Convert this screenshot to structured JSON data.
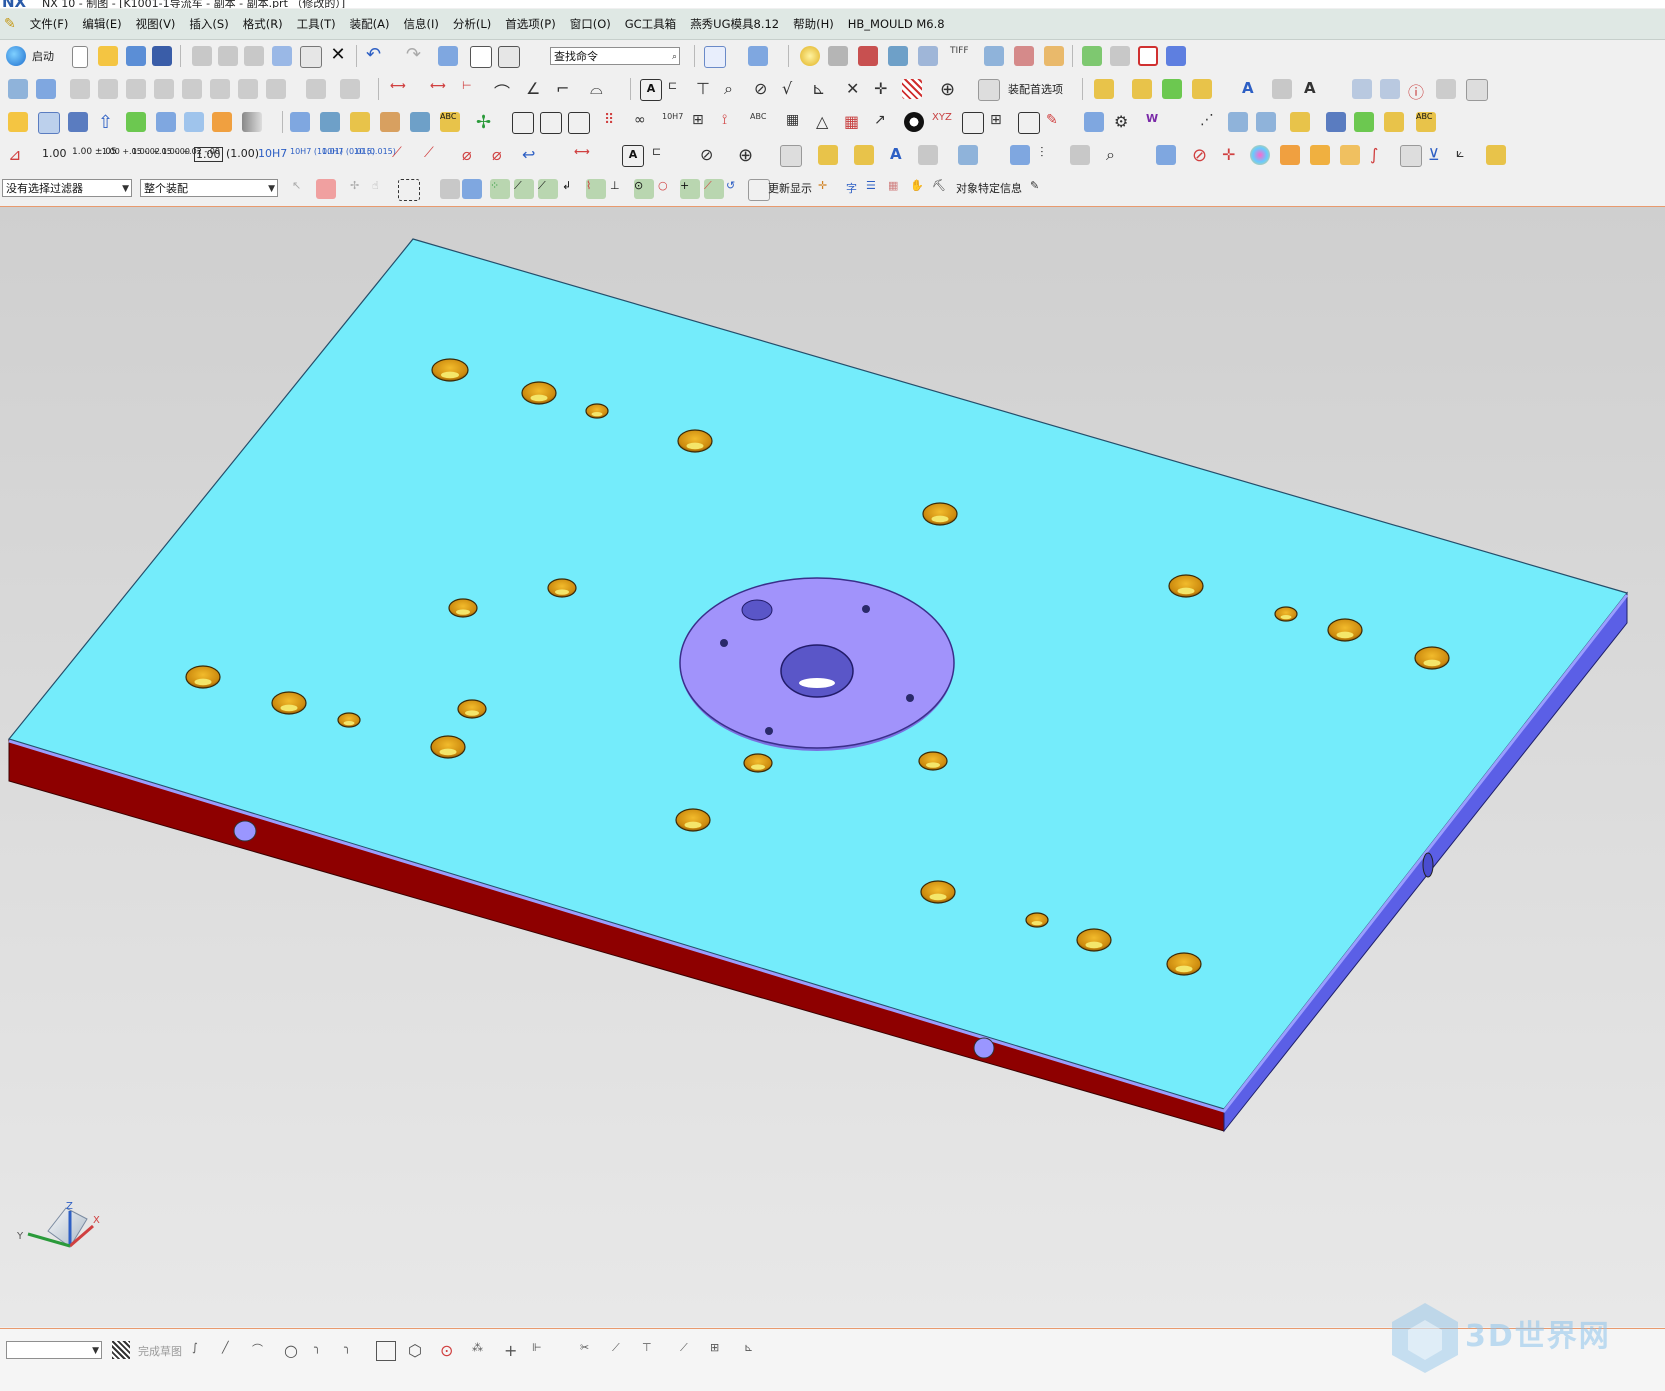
{
  "window": {
    "logo": "NX",
    "title": "NX 10 - 制图 - [K1001-1导流车 - 副本 - 副本.prt （修改的）]"
  },
  "menu": {
    "items": [
      "文件(F)",
      "编辑(E)",
      "视图(V)",
      "插入(S)",
      "格式(R)",
      "工具(T)",
      "装配(A)",
      "信息(I)",
      "分析(L)",
      "首选项(P)",
      "窗口(O)",
      "GC工具箱",
      "燕秀UG模具8.12",
      "帮助(H)",
      "HB_MOULD M6.8"
    ]
  },
  "toolbar1": {
    "start_label": "启动",
    "search_placeholder": "查找命令"
  },
  "toolbar2": {
    "assembly_prefs_label": "装配首选项"
  },
  "toolbar4": {
    "dim_100": "1.00",
    "tol_1": "1.00 ±.05",
    "tol_2": "1.00 +.05 -.02",
    "tol_3": "1.00 +.05 -.00",
    "tol_4": "1.00 +.02 -.00",
    "boxed_dim": "1.00",
    "paren_dim": "(1.00)",
    "fit_1": "10H7",
    "fit_2": "10H7 (10.01)",
    "fit_3": "10H7 (0.015)",
    "fit_4": "10 (0.015)"
  },
  "selection_bar": {
    "filter_value": "没有选择过滤器",
    "scope_value": "整个装配",
    "update_display_label": "更新显示",
    "char_label": "字",
    "object_info_label": "对象特定信息"
  },
  "sketch_bar": {
    "finish_sketch_label": "完成草图"
  },
  "triad": {
    "x": "X",
    "y": "Y",
    "z": "Z"
  },
  "watermark": {
    "text": "3D世界网"
  },
  "colors": {
    "plate_top": "#74ecfb",
    "plate_front": "#8e0000",
    "plate_side": "#5b5fe6",
    "counterbore": "#d79216",
    "hole_inner": "#f4e66a",
    "ring": "#a193fb",
    "menubar_bg": "#dfe8e4",
    "accent_line": "#e89a6e"
  }
}
